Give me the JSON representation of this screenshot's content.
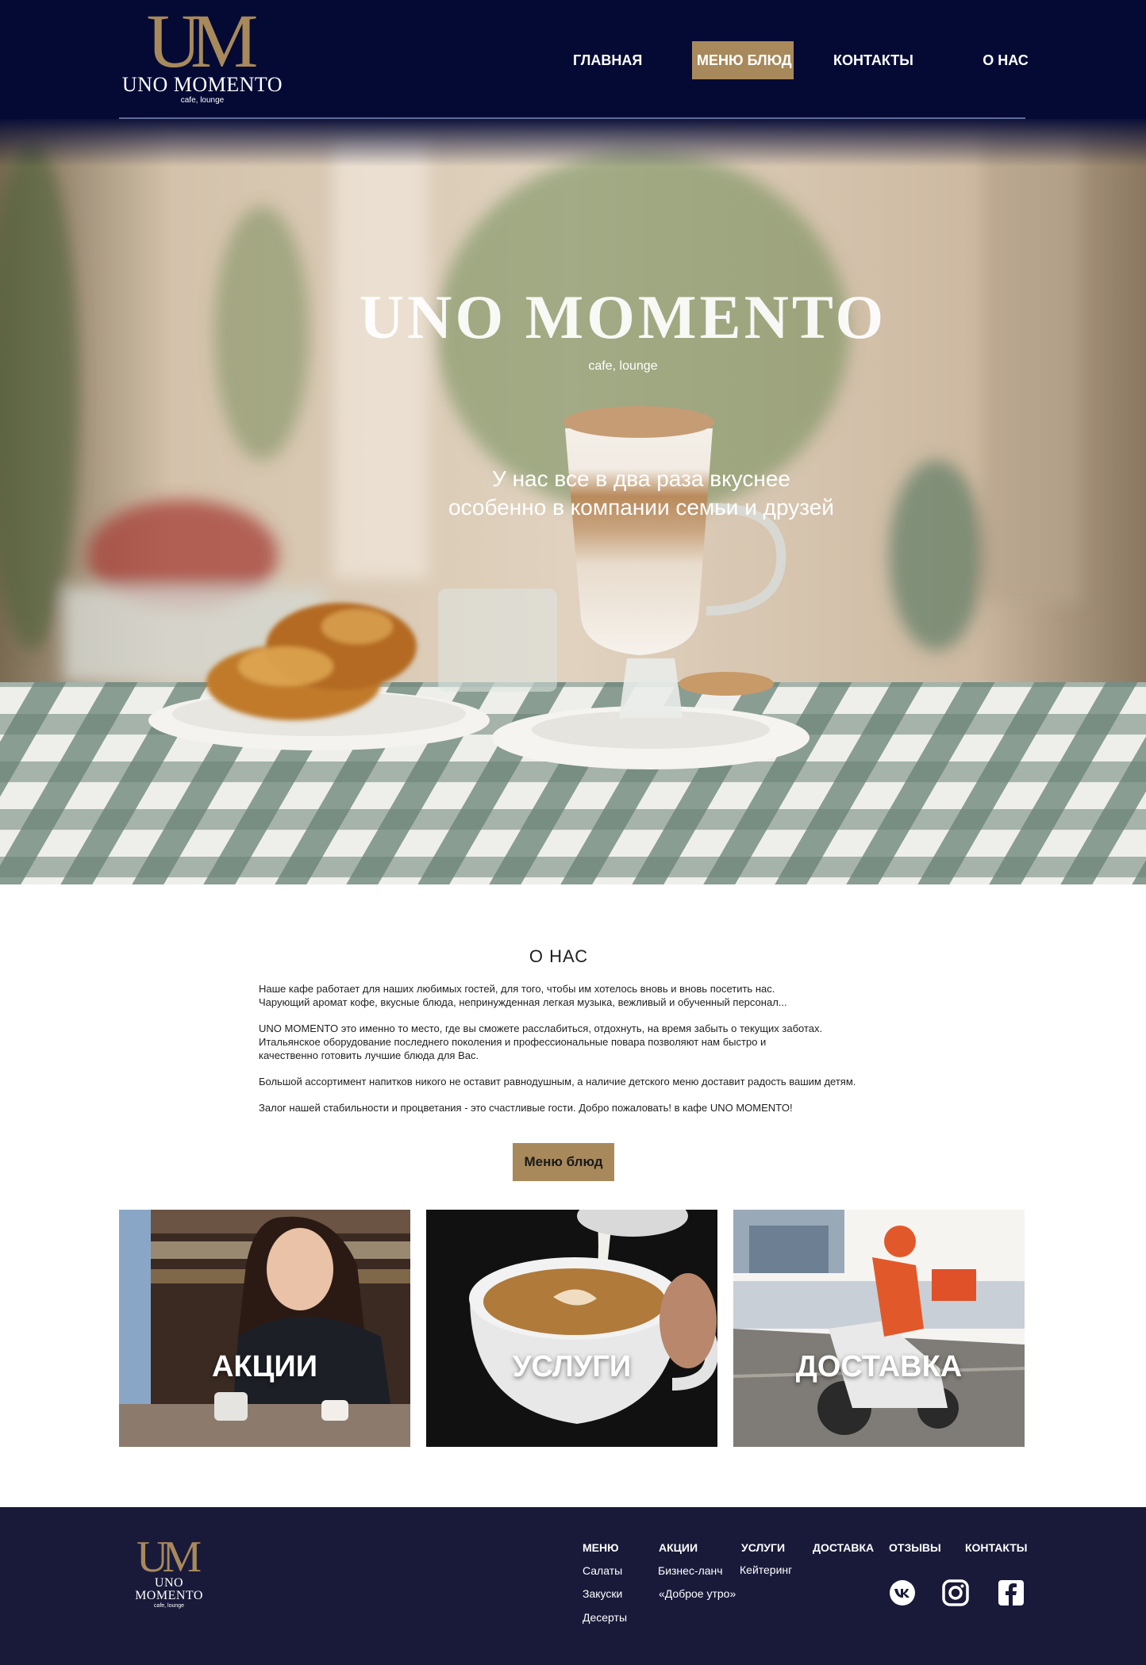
{
  "brand": {
    "mark": "UM",
    "name": "UNO MOMENTO",
    "tagline": "cafe, lounge"
  },
  "nav": {
    "items": [
      {
        "label": "ГЛАВНАЯ",
        "active": false
      },
      {
        "label": "МЕНЮ БЛЮД",
        "active": true
      },
      {
        "label": "КОНТАКТЫ",
        "active": false
      },
      {
        "label": "О НАС",
        "active": false
      }
    ]
  },
  "hero": {
    "title": "UNO MOMENTO",
    "subtitle": "cafe, lounge",
    "tagline_line1": "У нас все в два раза вкуснее",
    "tagline_line2": "особенно в компании семьи и друзей"
  },
  "about": {
    "title": "О НАС",
    "paragraphs": [
      "Наше кафе работает для наших любимых гостей, для того, чтобы им хотелось вновь и вновь посетить нас.\nЧарующий аромат кофе, вкусные блюда, непринужденная легкая музыка, вежливый и обученный персонал...",
      "UNO MOMENTO это именно то место, где вы сможете расслабиться, отдохнуть, на время забыть о текущих заботах.\nИтальянское оборудование последнего поколения и профессиональные повара позволяют нам быстро  и\n качественно готовить лучшие блюда для Вас.",
      "Большой ассортимент напитков никого не оставит равнодушным, а наличие детского меню доставит радость вашим детям.",
      "Залог нашей стабильности и процветания - это счастливые гости. Добро пожаловать!  в кафе UNO MOMENTO!"
    ],
    "button_label": "Меню блюд"
  },
  "tiles": [
    {
      "label": "АКЦИИ"
    },
    {
      "label": "УСЛУГИ"
    },
    {
      "label": "ДОСТАВКА"
    }
  ],
  "footer": {
    "columns": [
      {
        "heading": "МЕНЮ",
        "links": [
          "Салаты",
          "Закуски",
          "Десерты"
        ]
      },
      {
        "heading": "АКЦИИ",
        "links": [
          "Бизнес-ланч",
          "«Доброе утро»"
        ]
      },
      {
        "heading": "УСЛУГИ",
        "links": [
          "Кейтеринг"
        ]
      },
      {
        "heading": "ДОСТАВКА",
        "links": []
      },
      {
        "heading": "ОТЗЫВЫ",
        "links": []
      },
      {
        "heading": "КОНТАКТЫ",
        "links": []
      }
    ],
    "social": [
      "vk-icon",
      "instagram-icon",
      "facebook-icon"
    ]
  },
  "colors": {
    "navy": "#050a35",
    "footer_navy": "#191a3a",
    "gold": "#a8895b"
  }
}
